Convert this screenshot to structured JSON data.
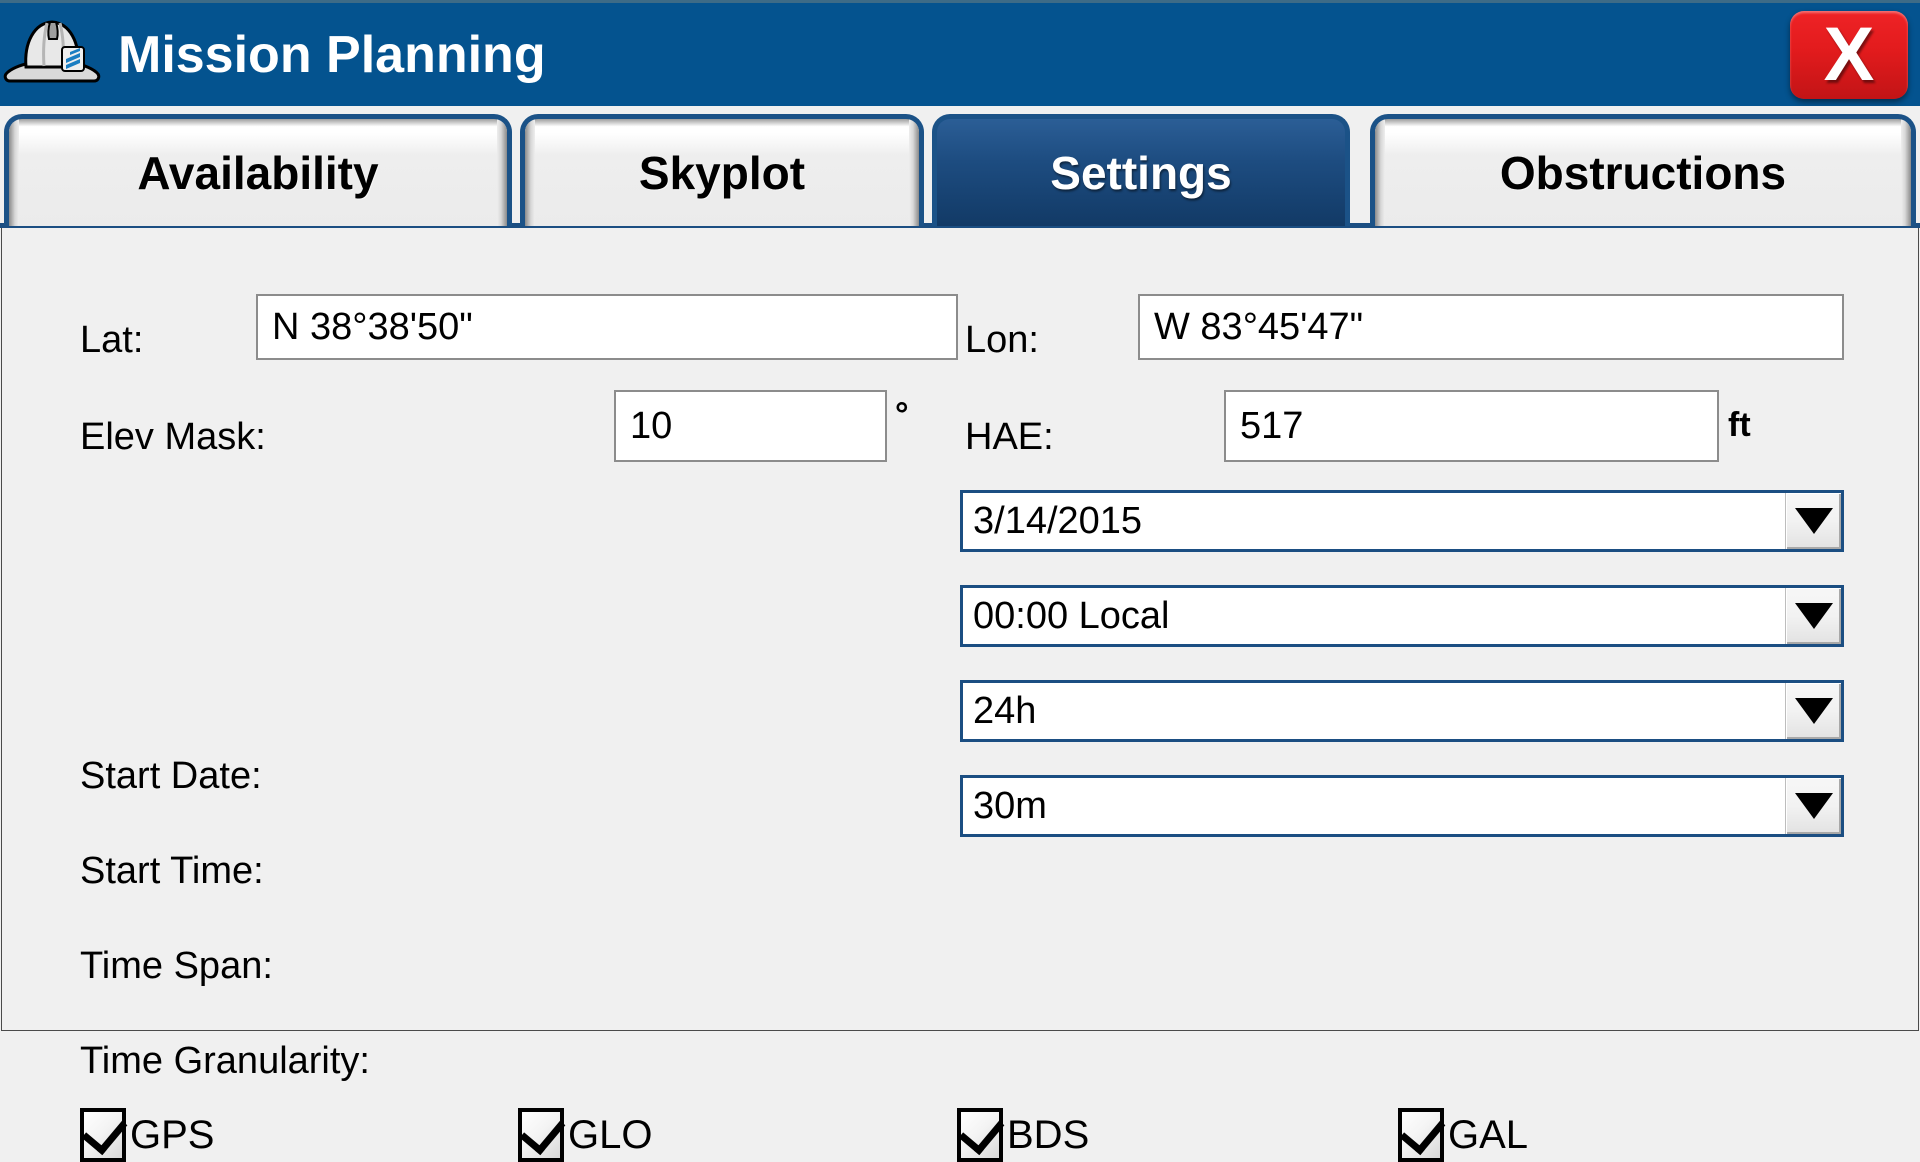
{
  "window": {
    "title": "Mission Planning",
    "icon": "hard-hat-icon",
    "close_label": "X",
    "titlebar_color": "#04538f",
    "accent_color": "#1b4e82",
    "close_color": "#e21b1d"
  },
  "tabs": [
    {
      "label": "Availability",
      "active": false
    },
    {
      "label": "Skyplot",
      "active": false
    },
    {
      "label": "Settings",
      "active": true
    },
    {
      "label": "Obstructions",
      "active": false
    }
  ],
  "settings": {
    "lat": {
      "label": "Lat:",
      "value": "N 38°38'50\""
    },
    "lon": {
      "label": "Lon:",
      "value": "W 83°45'47\""
    },
    "elev_mask": {
      "label": "Elev Mask:",
      "value": "10",
      "unit": "°"
    },
    "hae": {
      "label": "HAE:",
      "value": "517",
      "unit": "ft"
    },
    "start_date": {
      "label": "Start Date:",
      "value": "3/14/2015"
    },
    "start_time": {
      "label": "Start Time:",
      "value": "00:00 Local"
    },
    "time_span": {
      "label": "Time Span:",
      "value": "24h"
    },
    "time_granularity": {
      "label": "Time Granularity:",
      "value": "30m"
    },
    "constellations": [
      {
        "label": "GPS",
        "checked": true
      },
      {
        "label": "GLO",
        "checked": true
      },
      {
        "label": "BDS",
        "checked": true
      },
      {
        "label": "GAL",
        "checked": true
      }
    ]
  }
}
